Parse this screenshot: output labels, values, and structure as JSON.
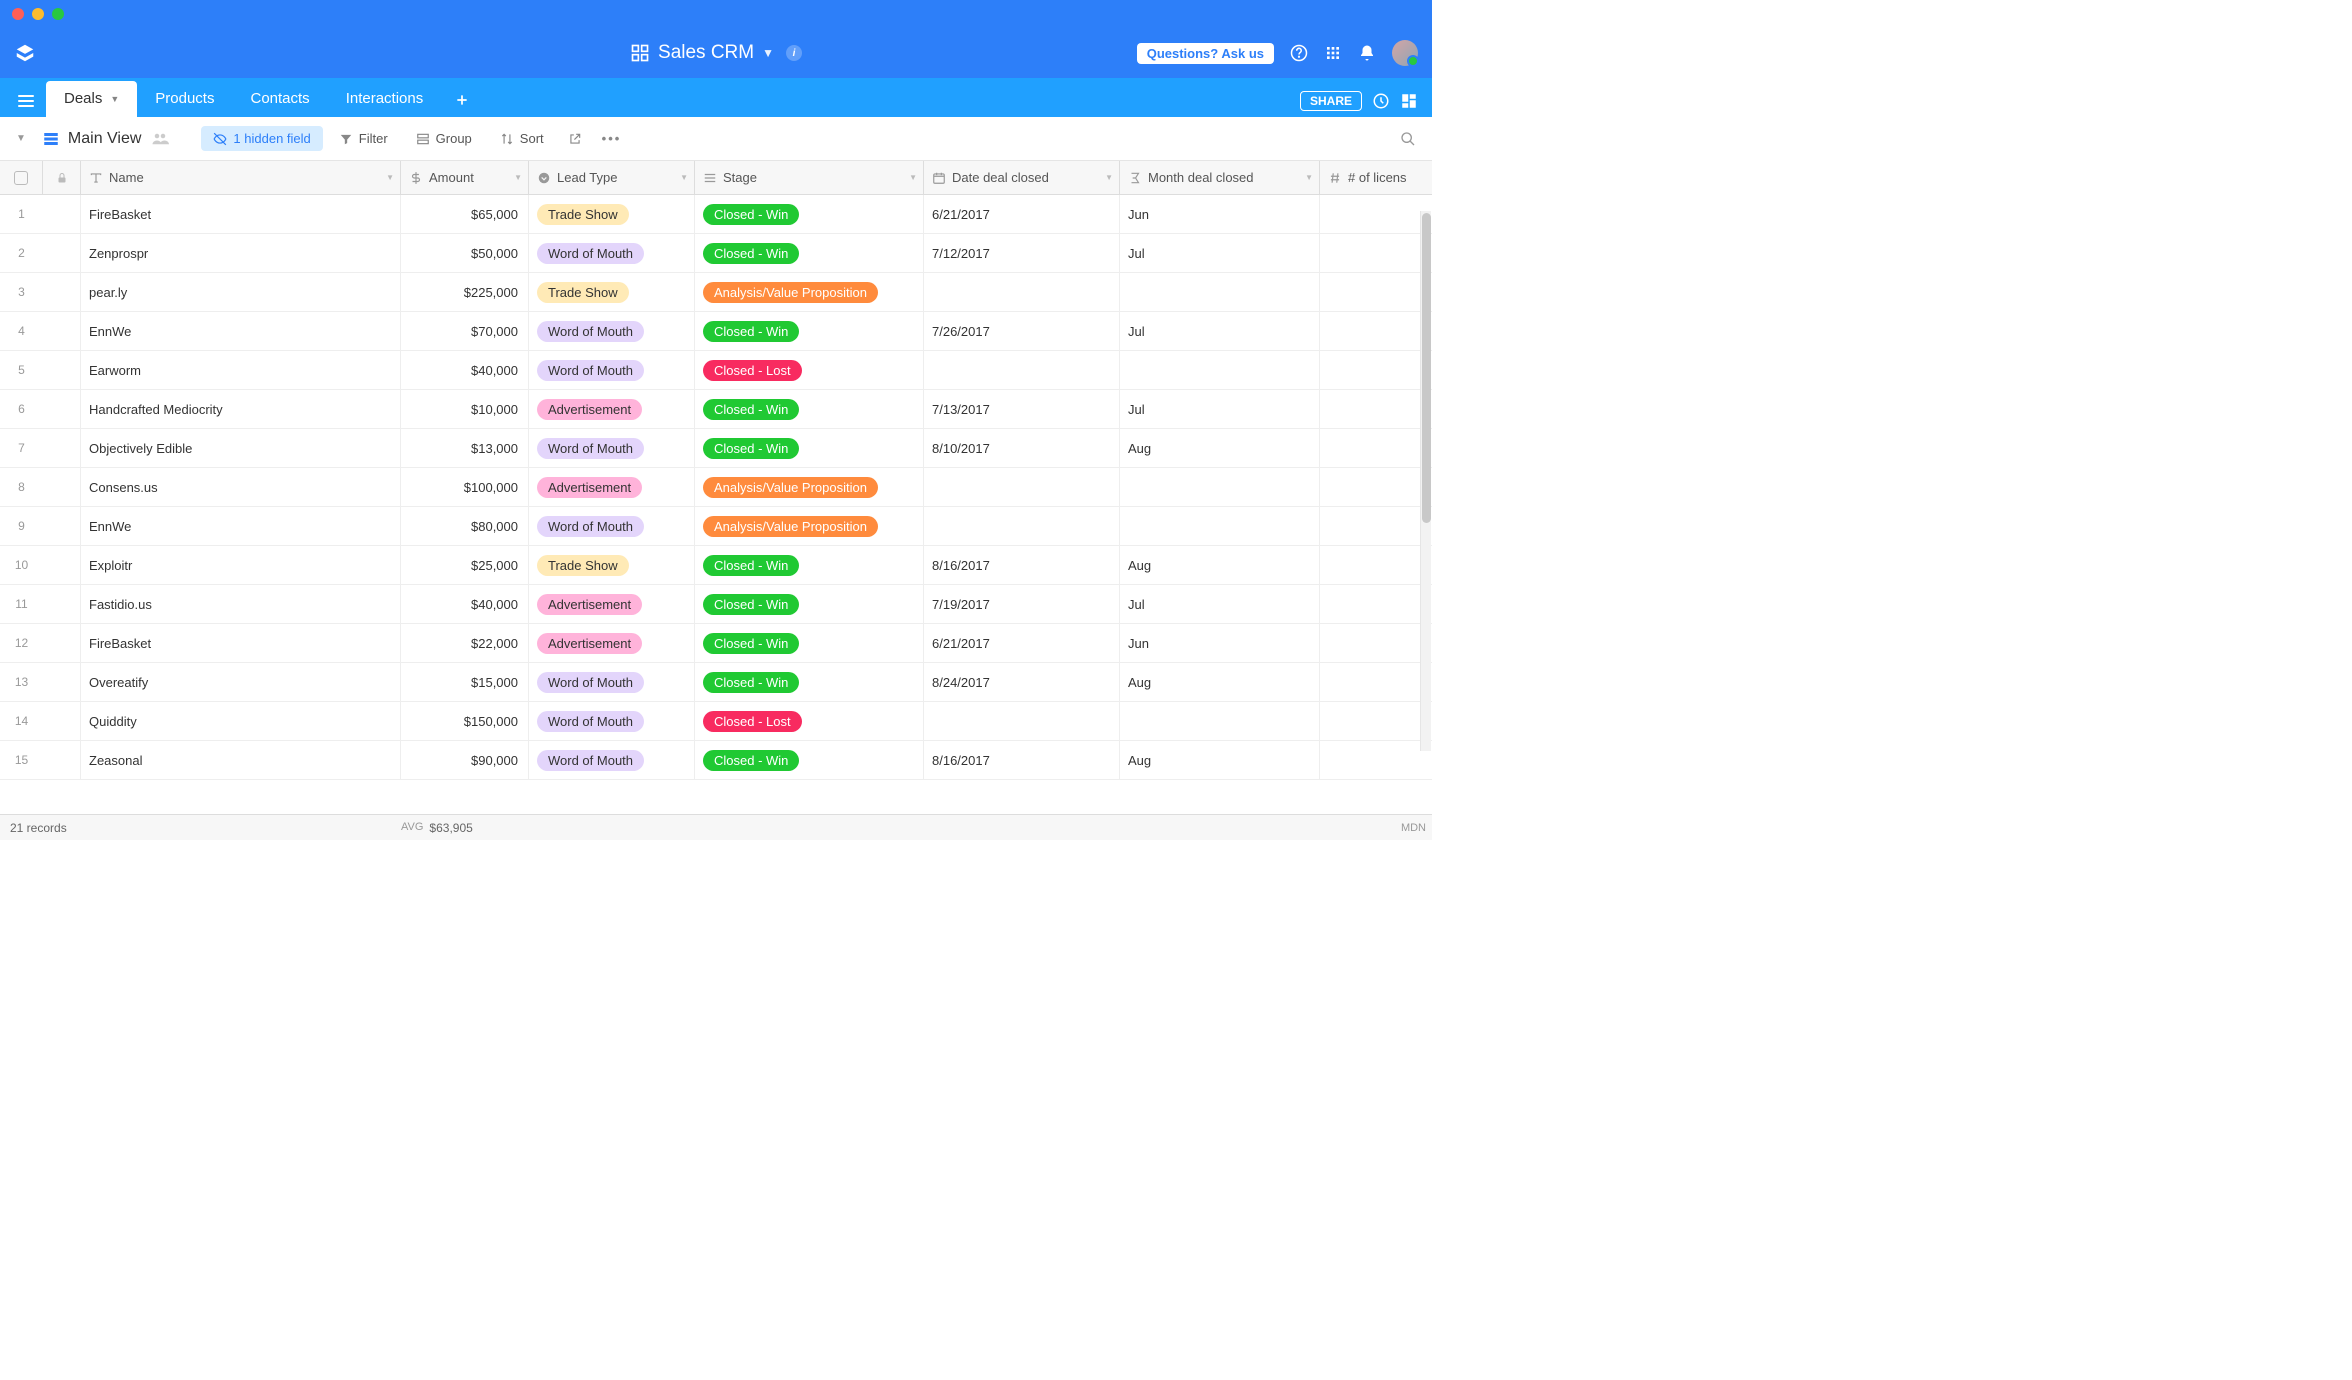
{
  "app": {
    "title": "Sales CRM",
    "ask_us": "Questions? Ask us",
    "share": "SHARE"
  },
  "tabs": [
    {
      "label": "Deals",
      "active": true
    },
    {
      "label": "Products",
      "active": false
    },
    {
      "label": "Contacts",
      "active": false
    },
    {
      "label": "Interactions",
      "active": false
    }
  ],
  "toolbar": {
    "view_name": "Main View",
    "hidden_fields": "1 hidden field",
    "filter": "Filter",
    "group": "Group",
    "sort": "Sort"
  },
  "columns": {
    "name": "Name",
    "amount": "Amount",
    "lead_type": "Lead Type",
    "stage": "Stage",
    "date_closed": "Date deal closed",
    "month_closed": "Month deal closed",
    "licenses": "# of licens"
  },
  "lead_colors": {
    "Trade Show": "pill-yellow",
    "Word of Mouth": "pill-purple",
    "Advertisement": "pill-pink"
  },
  "stage_colors": {
    "Closed - Win": "pill-green",
    "Analysis/Value Proposition": "pill-orange",
    "Closed - Lost": "pill-red"
  },
  "rows": [
    {
      "n": 1,
      "name": "FireBasket",
      "amount": "$65,000",
      "lead": "Trade Show",
      "stage": "Closed - Win",
      "date": "6/21/2017",
      "month": "Jun"
    },
    {
      "n": 2,
      "name": "Zenprospr",
      "amount": "$50,000",
      "lead": "Word of Mouth",
      "stage": "Closed - Win",
      "date": "7/12/2017",
      "month": "Jul"
    },
    {
      "n": 3,
      "name": "pear.ly",
      "amount": "$225,000",
      "lead": "Trade Show",
      "stage": "Analysis/Value Proposition",
      "date": "",
      "month": ""
    },
    {
      "n": 4,
      "name": "EnnWe",
      "amount": "$70,000",
      "lead": "Word of Mouth",
      "stage": "Closed - Win",
      "date": "7/26/2017",
      "month": "Jul"
    },
    {
      "n": 5,
      "name": "Earworm",
      "amount": "$40,000",
      "lead": "Word of Mouth",
      "stage": "Closed - Lost",
      "date": "",
      "month": ""
    },
    {
      "n": 6,
      "name": "Handcrafted Mediocrity",
      "amount": "$10,000",
      "lead": "Advertisement",
      "stage": "Closed - Win",
      "date": "7/13/2017",
      "month": "Jul"
    },
    {
      "n": 7,
      "name": "Objectively Edible",
      "amount": "$13,000",
      "lead": "Word of Mouth",
      "stage": "Closed - Win",
      "date": "8/10/2017",
      "month": "Aug"
    },
    {
      "n": 8,
      "name": "Consens.us",
      "amount": "$100,000",
      "lead": "Advertisement",
      "stage": "Analysis/Value Proposition",
      "date": "",
      "month": ""
    },
    {
      "n": 9,
      "name": "EnnWe",
      "amount": "$80,000",
      "lead": "Word of Mouth",
      "stage": "Analysis/Value Proposition",
      "date": "",
      "month": ""
    },
    {
      "n": 10,
      "name": "Exploitr",
      "amount": "$25,000",
      "lead": "Trade Show",
      "stage": "Closed - Win",
      "date": "8/16/2017",
      "month": "Aug"
    },
    {
      "n": 11,
      "name": "Fastidio.us",
      "amount": "$40,000",
      "lead": "Advertisement",
      "stage": "Closed - Win",
      "date": "7/19/2017",
      "month": "Jul"
    },
    {
      "n": 12,
      "name": "FireBasket",
      "amount": "$22,000",
      "lead": "Advertisement",
      "stage": "Closed - Win",
      "date": "6/21/2017",
      "month": "Jun"
    },
    {
      "n": 13,
      "name": "Overeatify",
      "amount": "$15,000",
      "lead": "Word of Mouth",
      "stage": "Closed - Win",
      "date": "8/24/2017",
      "month": "Aug"
    },
    {
      "n": 14,
      "name": "Quiddity",
      "amount": "$150,000",
      "lead": "Word of Mouth",
      "stage": "Closed - Lost",
      "date": "",
      "month": ""
    },
    {
      "n": 15,
      "name": "Zeasonal",
      "amount": "$90,000",
      "lead": "Word of Mouth",
      "stage": "Closed - Win",
      "date": "8/16/2017",
      "month": "Aug"
    }
  ],
  "footer": {
    "records": "21 records",
    "avg_label": "AVG",
    "avg_value": "$63,905",
    "attribution": "MDN"
  }
}
